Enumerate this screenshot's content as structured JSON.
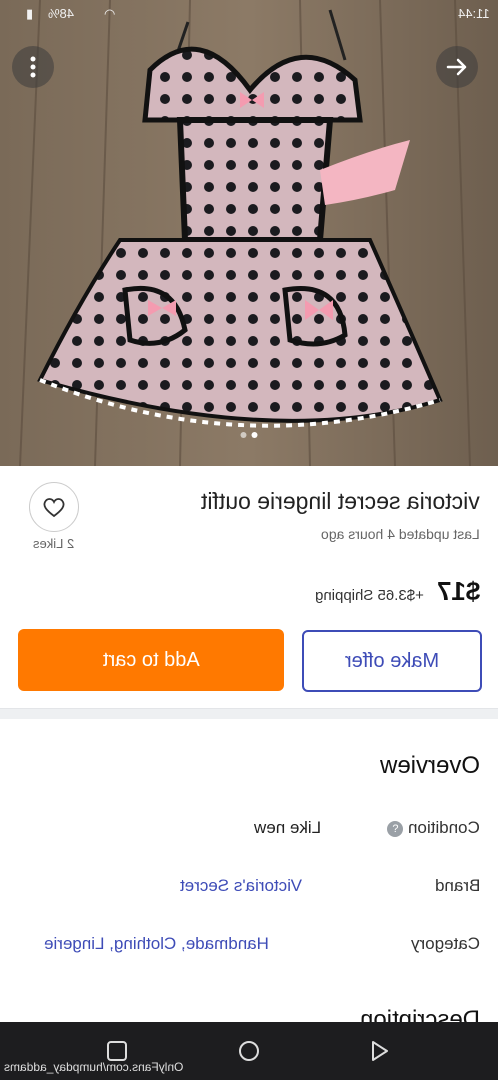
{
  "status_bar": {
    "time": "11:44",
    "battery": "48%"
  },
  "photo": {
    "indicator_count": 2,
    "active_index": 1
  },
  "listing": {
    "title": "victoria secret lingerie outfit",
    "updated": "Last updated 4 hours ago",
    "likes": "2 Likes",
    "price": "$17",
    "shipping": "+$3.65 Shipping"
  },
  "actions": {
    "add_to_cart": "Add to cart",
    "make_offer": "Make offer"
  },
  "overview": {
    "heading": "Overview",
    "condition_label": "Condition",
    "condition_value": "Like new",
    "brand_label": "Brand",
    "brand_value": "Victoria's Secret",
    "category_label": "Category",
    "category_value": "Handmade, Clothing, Lingerie"
  },
  "description": {
    "heading": "Description"
  },
  "watermark": "OnlyFans.com/humpday_addams",
  "colors": {
    "accent_orange": "#ff7900",
    "link_blue": "#3e4cb7",
    "nav_bg": "#1d1d1f"
  }
}
